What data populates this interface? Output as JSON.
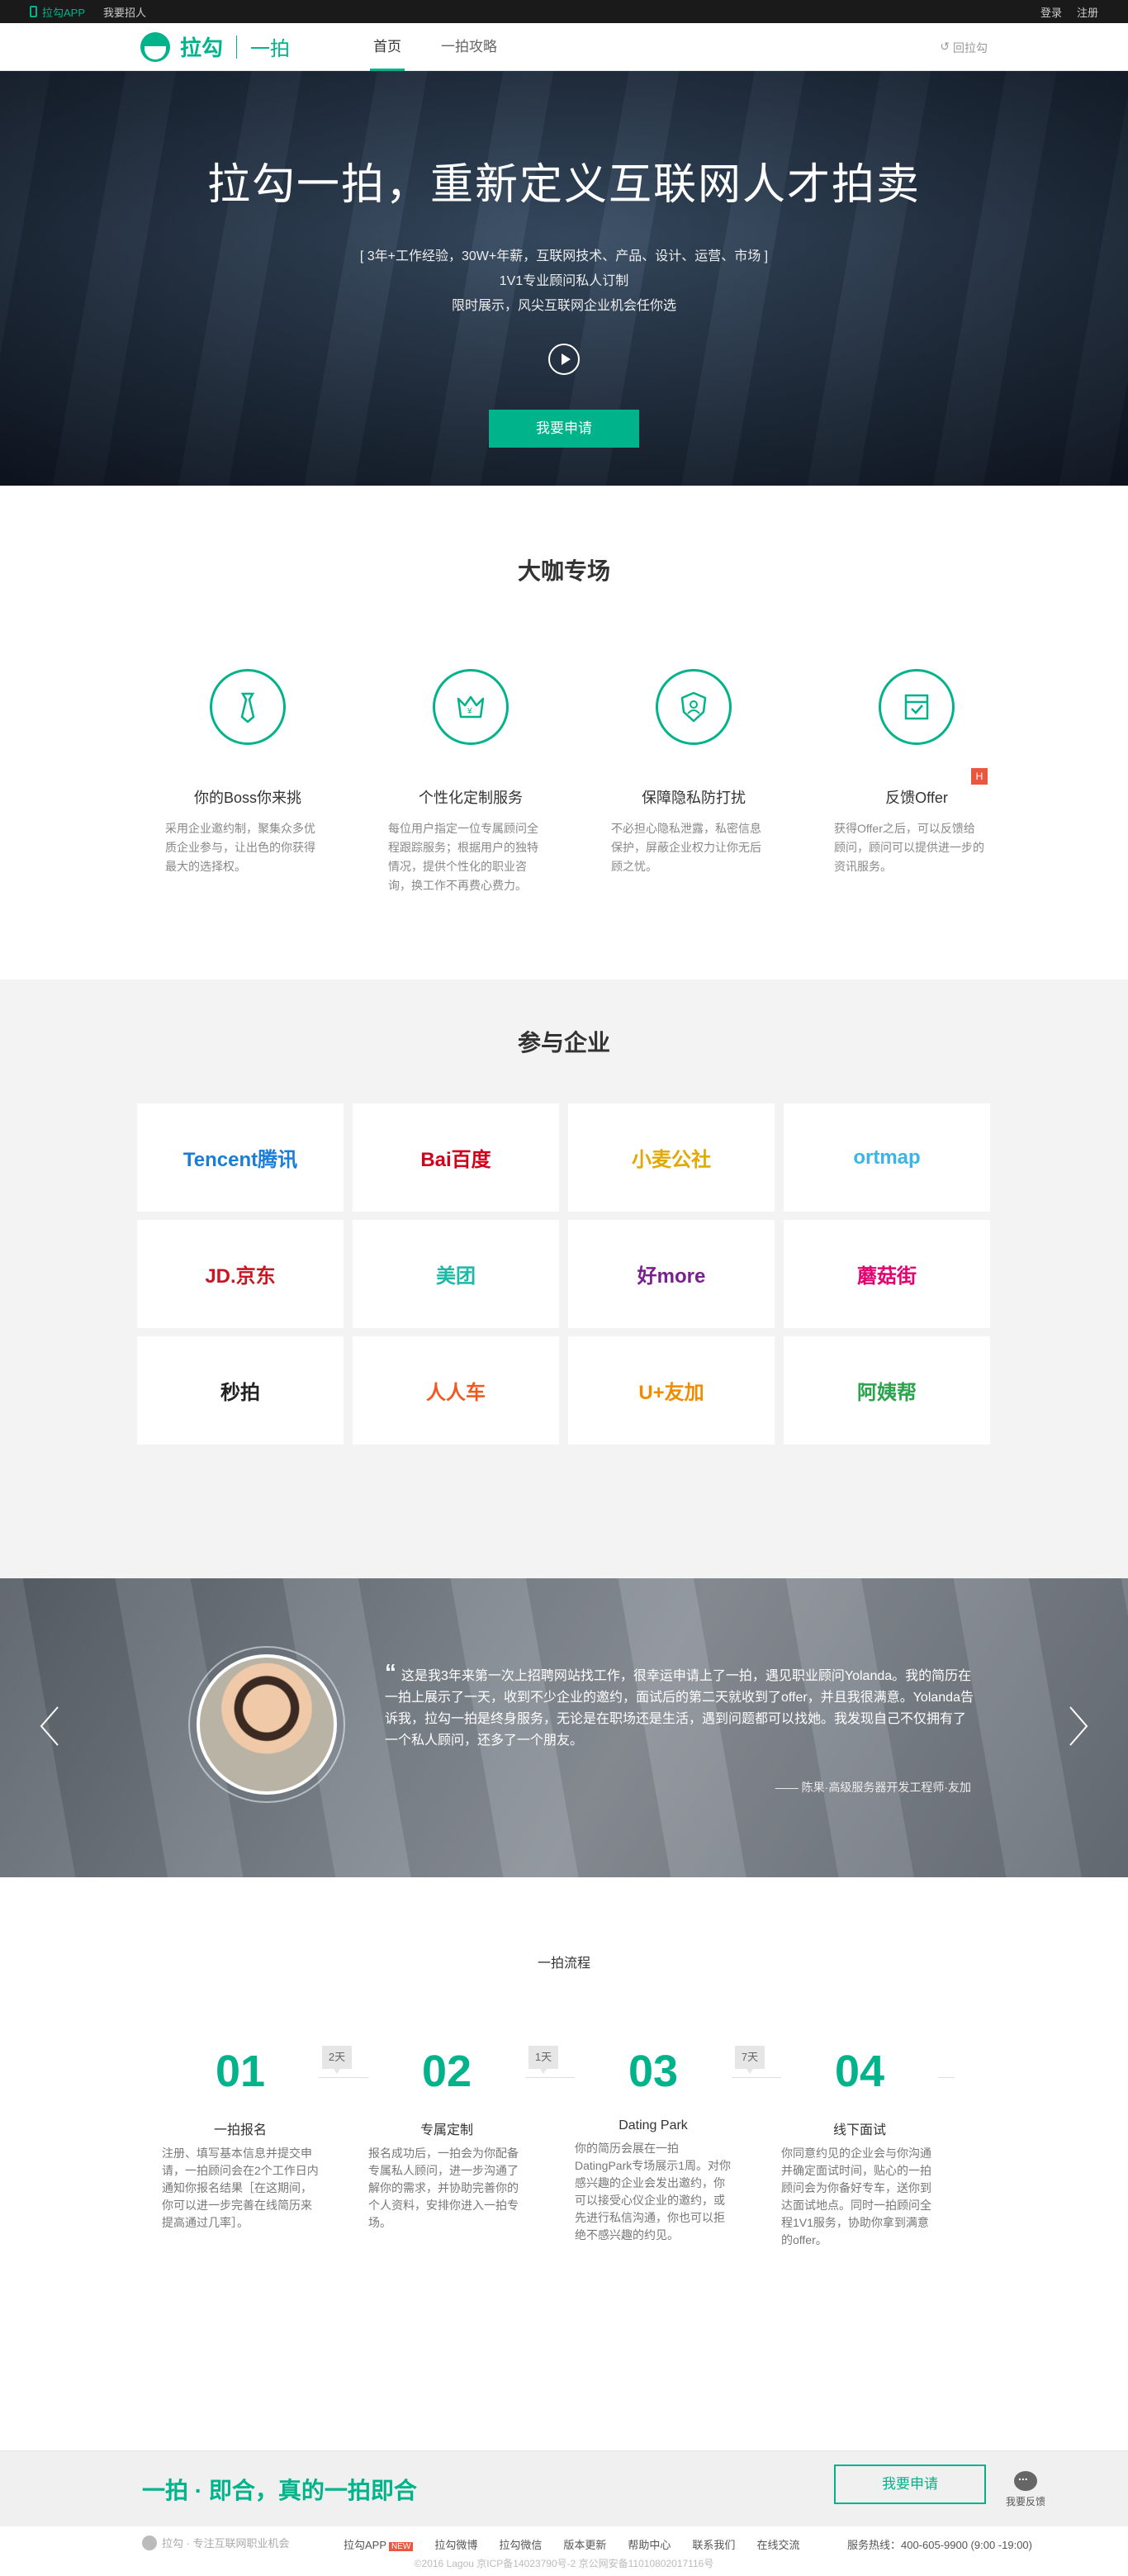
{
  "topbar": {
    "app": "拉勾APP",
    "recruit": "我要招人",
    "login": "登录",
    "register": "注册"
  },
  "nav": {
    "brand": "拉勾",
    "sub": "一拍",
    "links": [
      "首页",
      "一拍攻略"
    ],
    "back": "回拉勾"
  },
  "hero": {
    "title": "拉勾一拍，重新定义互联网人才拍卖",
    "lines": [
      "[ 3年+工作经验，30W+年薪，互联网技术、产品、设计、运营、市场 ]",
      "1V1专业顾问私人订制",
      "限时展示，风尖互联网企业机会任你选"
    ],
    "apply": "我要申请"
  },
  "features": {
    "title": "大咖专场",
    "items": [
      {
        "title": "你的Boss你来挑",
        "desc": "采用企业邀约制，聚集众多优质企业参与，让出色的你获得最大的选择权。",
        "icon": "tie-icon"
      },
      {
        "title": "个性化定制服务",
        "desc": "每位用户指定一位专属顾问全程跟踪服务；根据用户的独特情况，提供个性化的职业咨询，换工作不再费心费力。",
        "icon": "crown-icon"
      },
      {
        "title": "保障隐私防打扰",
        "desc": "不必担心隐私泄露，私密信息保护，屏蔽企业权力让你无后顾之忧。",
        "icon": "shield-icon"
      },
      {
        "title": "反馈Offer",
        "desc": "获得Offer之后，可以反馈给顾问，顾问可以提供进一步的资讯服务。",
        "icon": "offer-icon",
        "badge": "H"
      }
    ]
  },
  "companies": {
    "title": "参与企业",
    "items": [
      {
        "name": "Tencent腾讯",
        "color": "#1a7dd7"
      },
      {
        "name": "Bai百度",
        "color": "#d0021b"
      },
      {
        "name": "小麦公社",
        "color": "#e0a800"
      },
      {
        "name": "ortmap",
        "color": "#3cb4e6"
      },
      {
        "name": "JD.京东",
        "color": "#c81623"
      },
      {
        "name": "美团",
        "color": "#1db9a6"
      },
      {
        "name": "好more",
        "color": "#7a1f8f"
      },
      {
        "name": "蘑菇街",
        "color": "#e4006f"
      },
      {
        "name": "秒拍",
        "color": "#222222"
      },
      {
        "name": "人人车",
        "color": "#f05a22"
      },
      {
        "name": "U+友加",
        "color": "#f08c00"
      },
      {
        "name": "阿姨帮",
        "color": "#2ba24c"
      }
    ]
  },
  "testimonial": {
    "quote": "这是我3年来第一次上招聘网站找工作，很幸运申请上了一拍，遇见职业顾问Yolanda。我的简历在一拍上展示了一天，收到不少企业的邀约，面试后的第二天就收到了offer，并且我很满意。Yolanda告诉我，拉勾一拍是终身服务，无论是在职场还是生活，遇到问题都可以找她。我发现自己不仅拥有了一个私人顾问，还多了一个朋友。",
    "by": "—— 陈果·高级服务器开发工程师·友加"
  },
  "process": {
    "title": "一拍流程",
    "steps": [
      {
        "num": "01",
        "title": "一拍报名",
        "desc": "注册、填写基本信息并提交申请，一拍顾问会在2个工作日内通知你报名结果［在这期间，你可以进一步完善在线简历来提高通过几率］。"
      },
      {
        "num": "02",
        "title": "专属定制",
        "desc": "报名成功后，一拍会为你配备专属私人顾问，进一步沟通了解你的需求，并协助完善你的个人资料，安排你进入一拍专场。"
      },
      {
        "num": "03",
        "title": "Dating Park",
        "desc": "你的简历会展在一拍DatingPark专场展示1周。对你感兴趣的企业会发出邀约，你可以接受心仪企业的邀约，或先进行私信沟通，你也可以拒绝不感兴趣的约见。"
      },
      {
        "num": "04",
        "title": "线下面试",
        "desc": "你同意约见的企业会与你沟通并确定面试时间，贴心的一拍顾问会为你备好专车，送你到达面试地点。同时一拍顾问全程1V1服务，协助你拿到满意的offer。"
      }
    ],
    "days": [
      "2天",
      "1天",
      "7天"
    ]
  },
  "footer": {
    "slogan": "一拍 · 即合，真的一拍即合",
    "apply": "我要申请",
    "feedback": "我要反馈",
    "logo_text": "拉勾 · 专注互联网职业机会",
    "links": [
      "拉勾APP",
      "拉勾微博",
      "拉勾微信",
      "版本更新",
      "帮助中心",
      "联系我们",
      "在线交流"
    ],
    "new_badge": "NEW",
    "hotline": "服务热线：400-605-9900 (9:00 -19:00)",
    "copyright": "©2016 Lagou  京ICP备14023790号-2  京公网安备11010802017116号"
  }
}
